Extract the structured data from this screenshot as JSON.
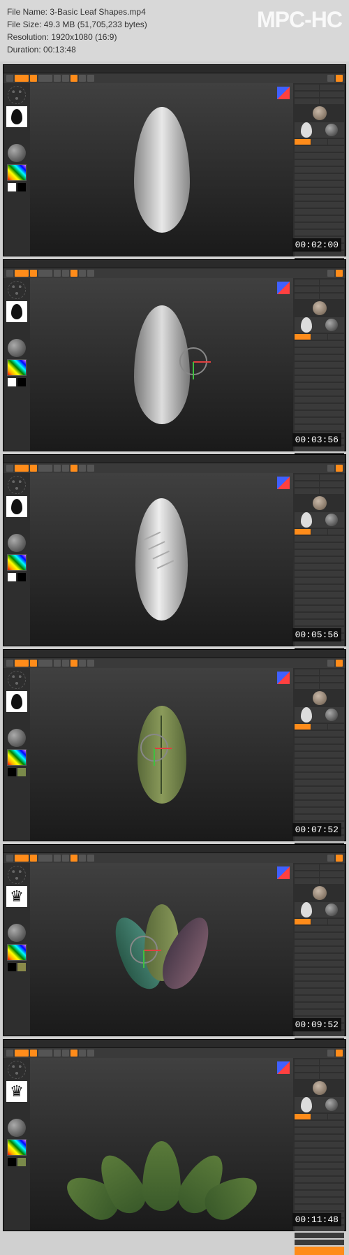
{
  "header": {
    "file_name_label": "File Name:",
    "file_name": "3-Basic Leaf Shapes.mp4",
    "file_size_label": "File Size:",
    "file_size": "49.3 MB (51,705,233 bytes)",
    "resolution_label": "Resolution:",
    "resolution": "1920x1080 (16:9)",
    "duration_label": "Duration:",
    "duration": "00:13:48"
  },
  "logo": "MPC-HC",
  "thumbnails": [
    {
      "timestamp": "00:02:00",
      "leaf_type": "plain_white",
      "swatch_left": "#ffffff",
      "swatch_right": "#000000",
      "thumb_icon": "leaf"
    },
    {
      "timestamp": "00:03:56",
      "leaf_type": "plain_white_gizmo",
      "swatch_left": "#ffffff",
      "swatch_right": "#000000",
      "thumb_icon": "leaf"
    },
    {
      "timestamp": "00:05:56",
      "leaf_type": "veined_white",
      "swatch_left": "#ffffff",
      "swatch_right": "#000000",
      "thumb_icon": "leaf"
    },
    {
      "timestamp": "00:07:52",
      "leaf_type": "green_single",
      "swatch_left": "#000000",
      "swatch_right": "#7a8a4a",
      "thumb_icon": "leaf"
    },
    {
      "timestamp": "00:09:52",
      "leaf_type": "three_leaves",
      "swatch_left": "#000000",
      "swatch_right": "#8a8a4a",
      "thumb_icon": "crown"
    },
    {
      "timestamp": "00:11:48",
      "leaf_type": "cluster",
      "swatch_left": "#000000",
      "swatch_right": "#7a8a4a",
      "thumb_icon": "crown"
    }
  ]
}
